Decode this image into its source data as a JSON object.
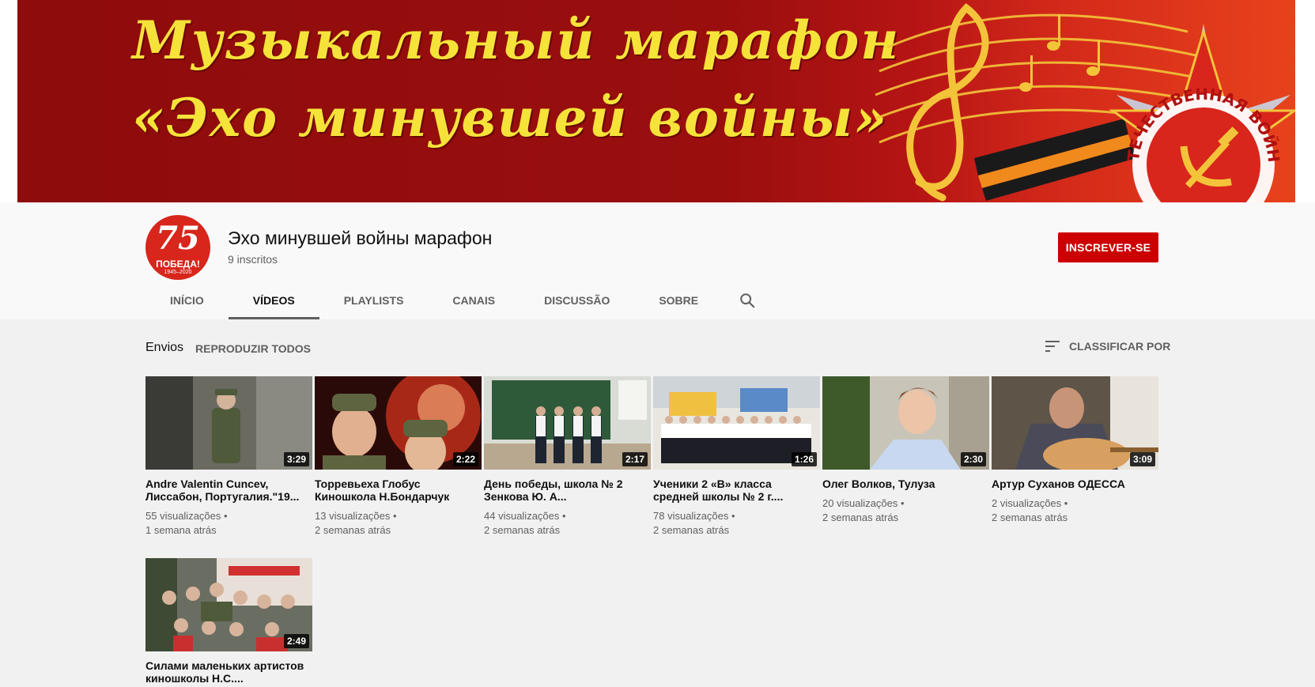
{
  "banner": {
    "line1": "Музыкальный марафон",
    "line2": "«Эхо минувшей войны»",
    "emblem_text": "ОТЕЧЕСТВЕННАЯ ВОЙНА"
  },
  "channel": {
    "avatar_number": "75",
    "avatar_word": "ПОБЕДА!",
    "avatar_years": "1945–2020",
    "title": "Эхо минувшей войны марафон",
    "subscribers": "9 inscritos",
    "subscribe_label": "INSCREVER-SE"
  },
  "tabs": [
    {
      "label": "INÍCIO"
    },
    {
      "label": "VÍDEOS"
    },
    {
      "label": "PLAYLISTS"
    },
    {
      "label": "CANAIS"
    },
    {
      "label": "DISCUSSÃO"
    },
    {
      "label": "SOBRE"
    }
  ],
  "section": {
    "title": "Envios",
    "play_all": "REPRODUZIR TODOS",
    "sort": "CLASSIFICAR POR"
  },
  "videos": [
    {
      "title": "Andre Valentin Cuncev, Лиссабон, Португалия.\"19...",
      "duration": "3:29",
      "views": "55 visualizações",
      "age": "1 semana atrás"
    },
    {
      "title": "Торревьеха Глобус Киношкола Н.Бондарчук",
      "duration": "2:22",
      "views": "13 visualizações",
      "age": "2 semanas atrás"
    },
    {
      "title": "День победы, школа № 2 Зенкова Ю. А...",
      "duration": "2:17",
      "views": "44 visualizações",
      "age": "2 semanas atrás"
    },
    {
      "title": "Ученики 2 «В» класса средней школы № 2 г....",
      "duration": "1:26",
      "views": "78 visualizações",
      "age": "2 semanas atrás"
    },
    {
      "title": "Олег Волков, Тулуза",
      "duration": "2:30",
      "views": "20 visualizações",
      "age": "2 semanas atrás"
    },
    {
      "title": "Артур Суханов ОДЕССА",
      "duration": "3:09",
      "views": "2 visualizações",
      "age": "2 semanas atrás"
    },
    {
      "title": "Силами маленьких артистов киношколы Н.С....",
      "duration": "2:49",
      "views": "",
      "age": ""
    }
  ],
  "colors": {
    "accent_red": "#cc0000",
    "banner_red": "#9a0e0e",
    "banner_text": "#f5e33a"
  }
}
